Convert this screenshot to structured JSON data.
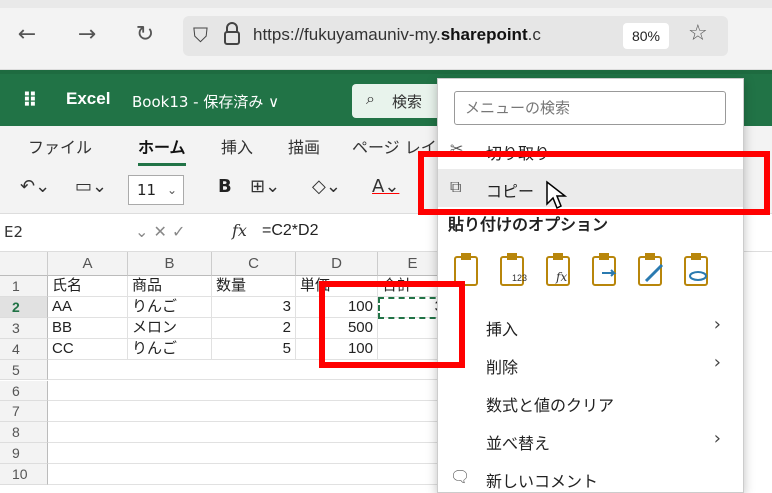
{
  "browser": {
    "url_prefix": "https://fukuyamauniv-my.",
    "url_domain": "sharepoint",
    "url_suffix": ".c",
    "zoom": "80%"
  },
  "app": {
    "name": "Excel",
    "doc_title": "Book13 - 保存済み ∨",
    "search_label": "検索"
  },
  "ribbon": {
    "tabs": [
      "ファイル",
      "ホーム",
      "挿入",
      "描画",
      "ページ レイ"
    ],
    "font_size": "11",
    "bold_label": "B"
  },
  "formula_bar": {
    "name_box": "E2",
    "formula": "=C2*D2",
    "fx_label": "fx"
  },
  "grid": {
    "columns": [
      "A",
      "B",
      "C",
      "D",
      "E"
    ],
    "rows": [
      "1",
      "2",
      "3",
      "4",
      "5",
      "6",
      "7",
      "8",
      "9",
      "10"
    ],
    "cells": {
      "a1": "氏名",
      "b1": "商品",
      "c1": "数量",
      "d1": "単価",
      "e1": "合計",
      "a2": "AA",
      "b2": "りんご",
      "c2": "3",
      "d2": "100",
      "e2": "3",
      "a3": "BB",
      "b3": "メロン",
      "c3": "2",
      "d3": "500",
      "a4": "CC",
      "b4": "りんご",
      "c4": "5",
      "d4": "100"
    }
  },
  "context_menu": {
    "search_placeholder": "メニューの検索",
    "cut": "切り取り",
    "copy": "コピー",
    "paste_options": "貼り付けのオプション",
    "paste_labels": [
      "123",
      "fx"
    ],
    "insert": "挿入",
    "delete": "削除",
    "clear": "数式と値のクリア",
    "sort": "並べ替え",
    "new_comment": "新しいコメント"
  },
  "colors": {
    "excel_green": "#217346",
    "highlight_red": "#ff0000"
  }
}
